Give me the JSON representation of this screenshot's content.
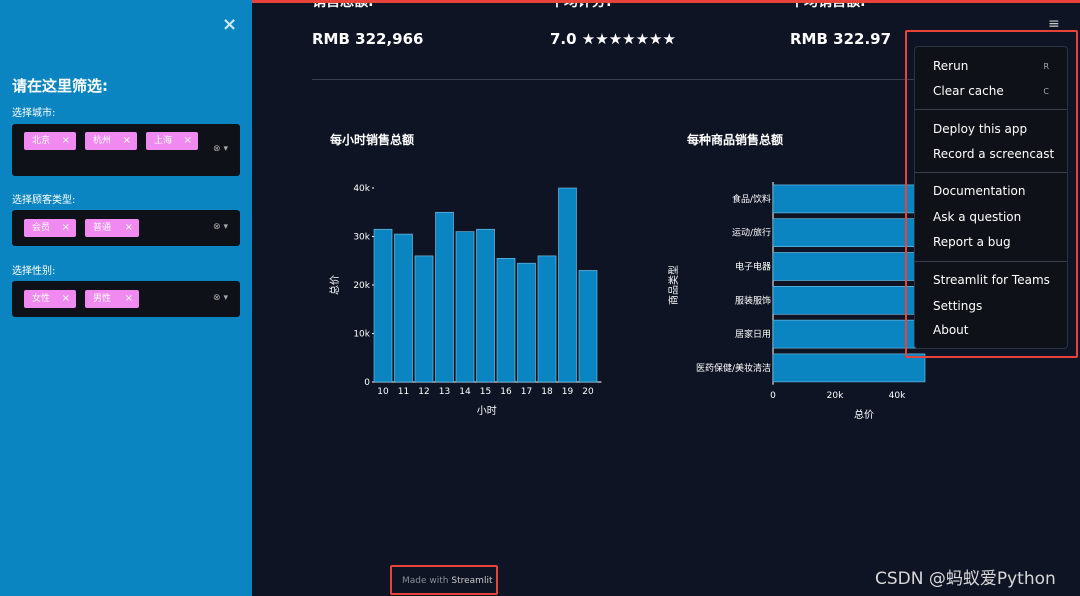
{
  "sidebar": {
    "close_icon": "×",
    "title": "请在这里筛选:",
    "filters": [
      {
        "label": "选择城市:",
        "tags": [
          "北京",
          "杭州",
          "上海"
        ]
      },
      {
        "label": "选择顾客类型:",
        "tags": [
          "会员",
          "普通"
        ]
      },
      {
        "label": "选择性别:",
        "tags": [
          "女性",
          "男性"
        ]
      }
    ],
    "tag_remove": "×",
    "clear_icon": "⊗",
    "dropdown_icon": "▾",
    "accent": "#0a85c1",
    "tag_color": "#f08af0"
  },
  "metrics": [
    {
      "label": "销售总额:",
      "value": "RMB 322,966"
    },
    {
      "label": "平均评分:",
      "value": "7.0 ★★★★★★★"
    },
    {
      "label": "平均销售额:",
      "value": "RMB 322.97"
    }
  ],
  "menu": {
    "hamburger_icon": "≡",
    "items": [
      {
        "label": "Rerun",
        "shortcut": "R"
      },
      {
        "label": "Clear cache",
        "shortcut": "C"
      },
      {
        "label": "Deploy this app",
        "shortcut": ""
      },
      {
        "label": "Record a screencast",
        "shortcut": ""
      },
      {
        "label": "Documentation",
        "shortcut": ""
      },
      {
        "label": "Ask a question",
        "shortcut": ""
      },
      {
        "label": "Report a bug",
        "shortcut": ""
      },
      {
        "label": "Streamlit for Teams",
        "shortcut": ""
      },
      {
        "label": "Settings",
        "shortcut": ""
      },
      {
        "label": "About",
        "shortcut": ""
      }
    ]
  },
  "footer": {
    "made_with": "Made with",
    "brand": "Streamlit"
  },
  "watermark": "CSDN @蚂蚁爱Python",
  "chart_data": [
    {
      "type": "bar",
      "title": "每小时销售总额",
      "categories": [
        "10",
        "11",
        "12",
        "13",
        "14",
        "15",
        "16",
        "17",
        "18",
        "19",
        "20"
      ],
      "values": [
        31500,
        30500,
        26000,
        35000,
        31000,
        31500,
        25500,
        24500,
        26000,
        40000,
        23000
      ],
      "xlabel": "小时",
      "ylabel": "总价",
      "ylim": [
        0,
        40000
      ],
      "yticks": [
        "0",
        "10k",
        "20k",
        "30k",
        "40k"
      ],
      "color": "#0a85c1"
    },
    {
      "type": "bar",
      "orientation": "horizontal",
      "title": "每种商品销售总额",
      "categories": [
        "食品/饮料",
        "运动/旅行",
        "电子电器",
        "服装服饰",
        "居家日用",
        "医药保健/美妆清洁"
      ],
      "values": [
        50000,
        50000,
        50000,
        50000,
        50000,
        50000
      ],
      "xlabel": "总价",
      "ylabel": "商品类型",
      "xticks": [
        "0",
        "20k",
        "40k"
      ],
      "color": "#0a85c1"
    }
  ]
}
